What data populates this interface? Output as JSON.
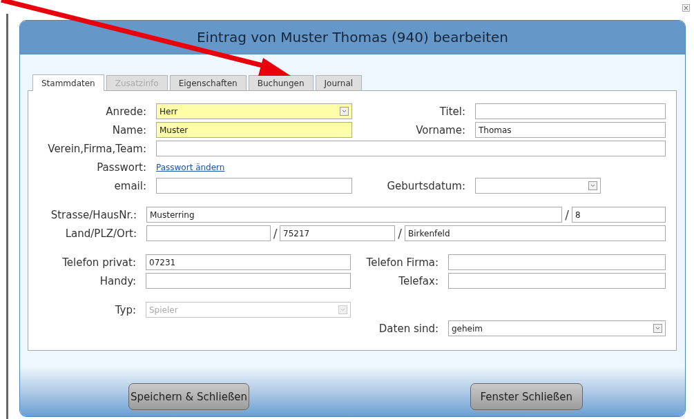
{
  "close_button": {
    "text": "×"
  },
  "dialog": {
    "title": "Eintrag von Muster Thomas (940) bearbeiten"
  },
  "tabs": [
    {
      "label": "Stammdaten",
      "selected": true,
      "disabled": false
    },
    {
      "label": "Zusatzinfo",
      "selected": false,
      "disabled": true
    },
    {
      "label": "Eigenschaften",
      "selected": false,
      "disabled": false
    },
    {
      "label": "Buchungen",
      "selected": false,
      "disabled": false
    },
    {
      "label": "Journal",
      "selected": false,
      "disabled": false
    }
  ],
  "sections": [
    {
      "rows": [
        {
          "kind": "double",
          "items": [
            {
              "kind": "label",
              "text": "Anrede:"
            },
            {
              "kind": "select",
              "value": "Herr",
              "required": true,
              "disabled": false
            },
            {
              "kind": "label",
              "text": "Titel:"
            },
            {
              "kind": "input",
              "required": false,
              "disabled": false
            }
          ]
        },
        {
          "kind": "double",
          "items": [
            {
              "kind": "label",
              "text": "Name:"
            },
            {
              "kind": "input",
              "value": "Muster",
              "required": true,
              "disabled": false
            },
            {
              "kind": "label",
              "text": "Vorname:"
            },
            {
              "kind": "input",
              "value": "Thomas",
              "required": false,
              "disabled": false
            }
          ]
        },
        {
          "kind": "wide",
          "items": [
            {
              "kind": "label",
              "text": "Verein,Firma,Team:"
            },
            {
              "kind": "input",
              "required": false,
              "disabled": false
            }
          ]
        },
        {
          "kind": "wide",
          "items": [
            {
              "kind": "label",
              "text": "Passwort:"
            },
            {
              "kind": "link",
              "text": "Passwort ändern"
            }
          ]
        },
        {
          "kind": "double-date",
          "items": [
            {
              "kind": "label",
              "text": "email:"
            },
            {
              "kind": "input",
              "required": false,
              "disabled": false
            },
            {
              "kind": "label",
              "text": "Geburtsdatum:"
            },
            {
              "kind": "select",
              "required": false,
              "disabled": false
            }
          ]
        }
      ]
    },
    {
      "rows": [
        {
          "kind": "street",
          "items": [
            {
              "kind": "label",
              "text": "Strasse/HausNr.:"
            },
            {
              "kind": "input",
              "value": "Musterring",
              "required": false,
              "disabled": false
            },
            {
              "kind": "slash",
              "text": "/"
            },
            {
              "kind": "input",
              "value": "8",
              "required": false,
              "disabled": false
            }
          ]
        },
        {
          "kind": "place",
          "items": [
            {
              "kind": "label",
              "text": "Land/PLZ/Ort:"
            },
            {
              "kind": "input",
              "required": false,
              "disabled": false
            },
            {
              "kind": "slash",
              "text": "/"
            },
            {
              "kind": "input",
              "value": "75217",
              "required": false,
              "disabled": false
            },
            {
              "kind": "slash",
              "text": "/"
            },
            {
              "kind": "input",
              "value": "Birkenfeld",
              "required": false,
              "disabled": false
            }
          ]
        }
      ]
    },
    {
      "rows": [
        {
          "kind": "phone",
          "items": [
            {
              "kind": "label",
              "text": "Telefon privat:"
            },
            {
              "kind": "input",
              "value": "07231",
              "required": false,
              "disabled": false
            },
            {
              "kind": "label",
              "text": "Telefon Firma:"
            },
            {
              "kind": "input",
              "required": false,
              "disabled": false
            }
          ]
        },
        {
          "kind": "phone",
          "items": [
            {
              "kind": "label",
              "text": "Handy:"
            },
            {
              "kind": "input",
              "required": false,
              "disabled": false
            },
            {
              "kind": "label",
              "text": "Telefax:"
            },
            {
              "kind": "input",
              "required": false,
              "disabled": false
            }
          ]
        }
      ]
    },
    {
      "rows": [
        {
          "kind": "phone",
          "items": [
            {
              "kind": "label",
              "text": "Typ:"
            },
            {
              "kind": "select",
              "value": "Spieler",
              "required": false,
              "disabled": true
            }
          ]
        },
        {
          "kind": "right",
          "items": [
            {
              "kind": "label",
              "text": "Daten sind:"
            },
            {
              "kind": "select",
              "value": "geheim",
              "required": false,
              "disabled": false
            }
          ]
        }
      ]
    }
  ],
  "buttons": [
    {
      "label": "Speichern & Schließen"
    },
    {
      "label": "Fenster Schließen"
    }
  ]
}
